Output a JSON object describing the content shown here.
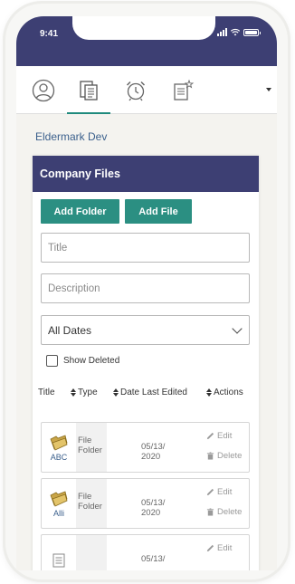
{
  "status": {
    "time": "9:41"
  },
  "nav": {
    "tabs": [
      {
        "icon": "person-icon"
      },
      {
        "icon": "documents-icon"
      },
      {
        "icon": "alarm-clock-icon"
      },
      {
        "icon": "notes-star-icon"
      }
    ],
    "active_index": 1,
    "more_icon": "caret-down-icon"
  },
  "org_name": "Eldermark Dev",
  "panel": {
    "title": "Company Files",
    "add_folder_label": "Add Folder",
    "add_file_label": "Add File",
    "title_placeholder": "Title",
    "description_placeholder": "Description",
    "date_filter": "All Dates",
    "show_deleted_label": "Show Deleted",
    "show_deleted_checked": false
  },
  "table": {
    "columns": {
      "title": "Title",
      "type": "Type",
      "date": "Date Last Edited",
      "actions": "Actions"
    },
    "edit_label": "Edit",
    "delete_label": "Delete",
    "rows": [
      {
        "thumb_label": "ABC",
        "type_line1": "File",
        "type_line2": "Folder",
        "date_line1": "05/13/",
        "date_line2": "2020",
        "icon": "folder-icon"
      },
      {
        "thumb_label": "Alli",
        "type_line1": "File",
        "type_line2": "Folder",
        "date_line1": "05/13/",
        "date_line2": "2020",
        "icon": "folder-icon"
      },
      {
        "thumb_label": "",
        "type_line1": "",
        "type_line2": "",
        "date_line1": "05/13/",
        "date_line2": "",
        "icon": "document-icon"
      }
    ]
  },
  "colors": {
    "header": "#3d3f73",
    "accent": "#2b8f82",
    "link": "#3a5f8c"
  }
}
